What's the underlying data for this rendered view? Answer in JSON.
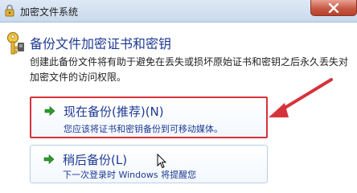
{
  "window": {
    "title": "加密文件系统",
    "title_icon": "key-lock-icon",
    "close_icon": "close-icon"
  },
  "header": {
    "icon": "key-icon",
    "title": "备份文件加密证书和密钥",
    "description": "创建此备份文件将有助于避免在丢失或损坏原始证书和密钥之后永久丢失对加密文件的访问权限。"
  },
  "options": [
    {
      "label": "现在备份(推荐)(N)",
      "sublabel": "您应该将证书和密钥备份到可移动媒体。",
      "highlighted": true,
      "icon": "green-arrow-icon"
    },
    {
      "label": "稍后备份(L)",
      "sublabel": "下一次登录时 Windows 将提醒您",
      "highlighted": false,
      "icon": "green-arrow-icon"
    }
  ],
  "colors": {
    "link_blue": "#1f3a93",
    "highlight_red": "#d7323b",
    "arrow_green": "#2e9a2e",
    "close_red": "#c75a45"
  }
}
